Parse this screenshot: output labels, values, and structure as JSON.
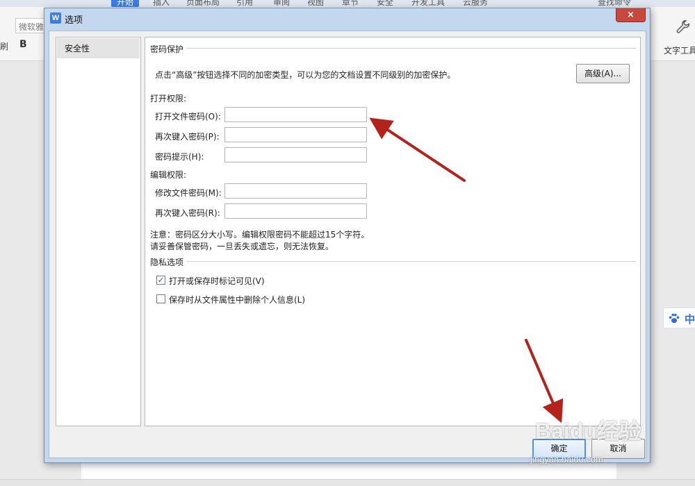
{
  "app": {
    "ribbon_tabs": [
      {
        "label": "开始",
        "active": true
      },
      {
        "label": "插入"
      },
      {
        "label": "页面布局"
      },
      {
        "label": "引用"
      },
      {
        "label": "审阅"
      },
      {
        "label": "视图"
      },
      {
        "label": "章节"
      },
      {
        "label": "安全"
      },
      {
        "label": "开发工具"
      },
      {
        "label": "云服务"
      }
    ],
    "search_label": "查找命令",
    "font_name": "微软雅黑",
    "bold_label": "B",
    "left_cut_label": "刷",
    "tools_label": "文字工具",
    "side_chip_text": "中"
  },
  "dialog": {
    "title": "选项",
    "close_label": "×",
    "sidebar": {
      "items": [
        {
          "label": "安全性",
          "selected": true
        }
      ]
    },
    "password_protection": {
      "heading": "密码保护",
      "description": "点击“高级”按钮选择不同的加密类型，可以为您的文档设置不同级别的加密保护。",
      "advanced_button": "高级(A)..."
    },
    "open_permission": {
      "heading": "打开权限:",
      "fields": [
        {
          "label": "打开文件密码(O):",
          "value": ""
        },
        {
          "label": "再次键入密码(P):",
          "value": ""
        },
        {
          "label": "密码提示(H):",
          "value": ""
        }
      ]
    },
    "edit_permission": {
      "heading": "编辑权限:",
      "fields": [
        {
          "label": "修改文件密码(M):",
          "value": ""
        },
        {
          "label": "再次键入密码(R):",
          "value": ""
        }
      ]
    },
    "notes": [
      "注意：密码区分大小写。编辑权限密码不能超过15个字符。",
      "请妥善保管密码，一旦丢失或遗忘，则无法恢复。"
    ],
    "privacy": {
      "heading": "隐私选项",
      "options": [
        {
          "label": "打开或保存时标记可见(V)",
          "checked": true
        },
        {
          "label": "保存时从文件属性中删除个人信息(L)",
          "checked": false
        }
      ]
    },
    "ok_label": "确定",
    "cancel_label": "取消"
  },
  "watermark": {
    "brand": "Baidu经验",
    "url": "jingyan.baidu.com"
  },
  "colors": {
    "annotation_arrow": "#b3231c",
    "accent": "#3c7be0",
    "close": "#c9483c"
  }
}
